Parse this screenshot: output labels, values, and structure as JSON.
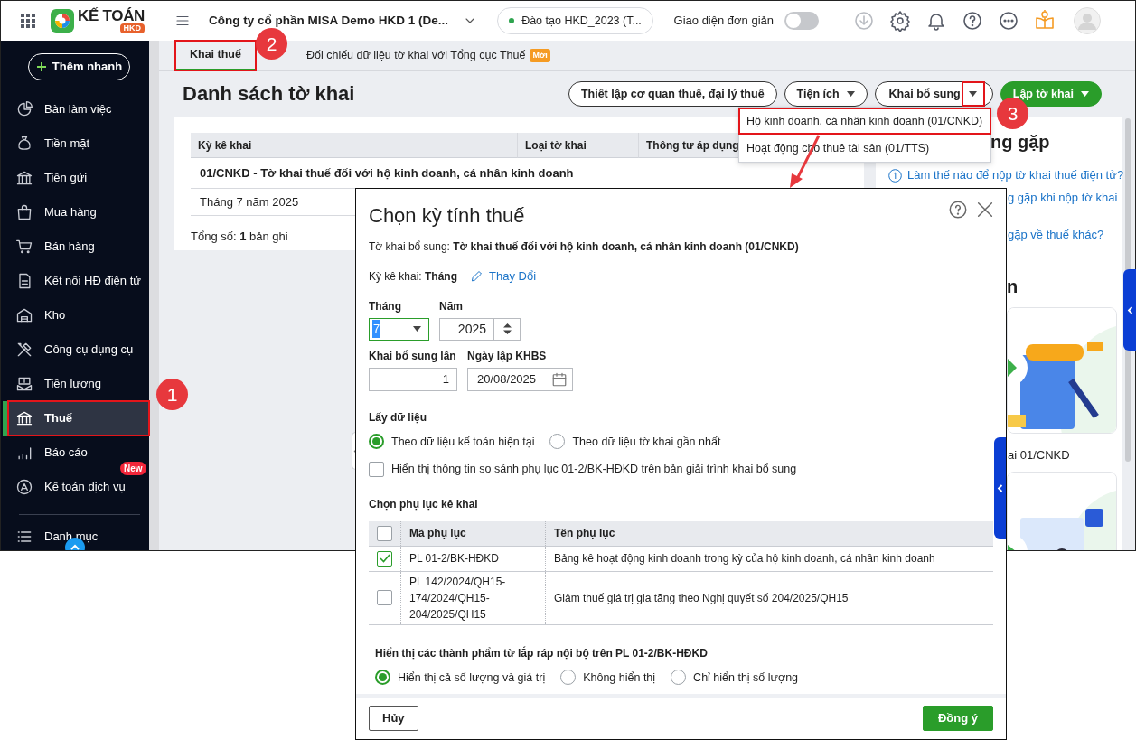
{
  "topbar": {
    "logo": {
      "name": "KẾ TOÁN",
      "badge": "HKD"
    },
    "company": "Công ty cổ phần MISA Demo HKD 1 (De...",
    "environment": "Đào tạo HKD_2023 (T...",
    "simple_mode": {
      "label": "Giao diện đơn giản",
      "on": false
    }
  },
  "sidebar": {
    "quick_add": "Thêm nhanh",
    "items": [
      {
        "label": "Bàn làm việc",
        "selected": false
      },
      {
        "label": "Tiền mặt",
        "selected": false
      },
      {
        "label": "Tiền gửi",
        "selected": false
      },
      {
        "label": "Mua hàng",
        "selected": false
      },
      {
        "label": "Bán hàng",
        "selected": false
      },
      {
        "label": "Kết nối HĐ điện tử",
        "selected": false
      },
      {
        "label": "Kho",
        "selected": false
      },
      {
        "label": "Công cụ dụng cụ",
        "selected": false
      },
      {
        "label": "Tiền lương",
        "selected": false
      },
      {
        "label": "Thuế",
        "selected": true,
        "highlighted": true
      },
      {
        "label": "Báo cáo",
        "selected": false
      },
      {
        "label": "Kế toán dịch vụ",
        "selected": false,
        "badge": "New"
      }
    ],
    "footer_items": [
      {
        "label": "Danh mục"
      }
    ]
  },
  "tabs": [
    {
      "label": "Khai thuế",
      "selected": true,
      "highlighted": true
    },
    {
      "label": "Đối chiếu dữ liệu tờ khai với Tổng cục Thuế",
      "selected": false,
      "badge": "Mới"
    }
  ],
  "page": {
    "title": "Danh sách tờ khai",
    "actions": [
      {
        "label": "Thiết lập cơ quan thuế, đại lý thuế",
        "kind": "outline"
      },
      {
        "label": "Tiện ích",
        "kind": "dropdown"
      },
      {
        "label": "Khai bổ sung",
        "kind": "split",
        "caret_highlighted": true
      },
      {
        "label": "Lập tờ khai",
        "kind": "primary"
      }
    ]
  },
  "dropdown_menu": {
    "items": [
      {
        "label": "Hộ kinh doanh, cá nhân kinh doanh (01/CNKD)",
        "highlighted": true
      },
      {
        "label": "Hoạt động cho thuê tài sản (01/TTS)",
        "highlighted": false
      }
    ]
  },
  "table": {
    "columns": [
      "Kỳ kê khai",
      "Loại tờ khai",
      "Thông tư áp dụng"
    ],
    "groups": [
      {
        "title": "01/CNKD - Tờ khai thuế đối với hộ kinh doanh, cá nhân kinh doanh",
        "rows": [
          [
            "Tháng 7 năm 2025"
          ]
        ]
      }
    ],
    "total": "Tổng số: **1** bản ghi"
  },
  "help_panel": {
    "heading": "ng gặp",
    "links": [
      "Làm thế nào để nộp tờ khai thuế điện tử?",
      "g gặp khi nộp tờ khai",
      "gặp về thuế khác?"
    ],
    "section_heading": "n",
    "videos": [
      {
        "kind": "picture",
        "caption": "ai 01/CNKD"
      },
      {
        "kind": "picture"
      }
    ]
  },
  "annotations": {
    "steps": [
      "1",
      "2",
      "3"
    ]
  },
  "dialog": {
    "title": "Chọn kỳ tính thuế",
    "subtitle": "Tờ khai bổ sung: **Tờ khai thuế đối với hộ kinh doanh, cá nhân kinh doanh (01/CNKD)**",
    "period": "Kỳ kê khai: **Tháng**",
    "change_link": "Thay Đổi",
    "month": {
      "label": "Tháng",
      "value": "7"
    },
    "year": {
      "label": "Năm",
      "value": "2025"
    },
    "supplement_no": {
      "label": "Khai bổ sung lần",
      "value": "1"
    },
    "date": {
      "label": "Ngày lập KHBS",
      "value": "20/08/2025"
    },
    "data_source": {
      "label": "Lấy dữ liệu",
      "options": [
        {
          "label": "Theo dữ liệu kế toán hiện tại",
          "selected": true
        },
        {
          "label": "Theo dữ liệu tờ khai gần nhất",
          "selected": false
        }
      ]
    },
    "compare": {
      "label": "Hiển thị thông tin so sánh phụ lục 01-2/BK-HĐKD trên bản giải trình khai bổ sung",
      "checked": false
    },
    "appendix": {
      "title": "Chọn phụ lục kê khai",
      "columns": [
        "Mã phụ lục",
        "Tên phụ lục"
      ],
      "all_checked": false,
      "rows": [
        {
          "code": "PL 01-2/BK-HĐKD",
          "name": "Bảng kê hoạt động kinh doanh trong kỳ của hộ kinh doanh, cá nhân kinh doanh",
          "checked": true
        },
        {
          "code": "PL 142/2024/QH15-174/2024/QH15-204/2025/QH15",
          "name": "Giảm thuế giá trị gia tăng theo Nghị quyết số 204/2025/QH15",
          "checked": false
        }
      ]
    },
    "products": {
      "title": "Hiển thị các thành phẩm từ lắp ráp nội bộ trên PL 01-2/BK-HĐKD",
      "options": [
        {
          "label": "Hiển thị cả số lượng và giá trị",
          "selected": true
        },
        {
          "label": "Không hiển thị",
          "selected": false
        },
        {
          "label": "Chỉ hiển thị số lượng",
          "selected": false
        }
      ]
    },
    "buttons": [
      {
        "label": "Hủy",
        "kind": "secondary"
      },
      {
        "label": "Đồng ý",
        "kind": "primary"
      }
    ]
  }
}
